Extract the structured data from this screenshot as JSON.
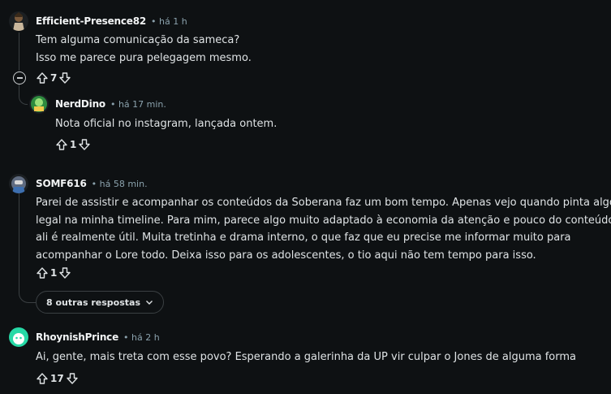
{
  "comments": [
    {
      "author": "Efficient-Presence82",
      "time": "há 1 h",
      "lines": [
        "Tem alguma comunicação da sameca?",
        "Isso me parece pura pelegagem mesmo."
      ],
      "votes": "7",
      "avatar_icon": "snoo-avatar-icon"
    },
    {
      "author": "NerdDino",
      "time": "há 17 min.",
      "lines": [
        "Nota oficial no instagram, lançada ontem."
      ],
      "votes": "1",
      "avatar_icon": "snoo-avatar-icon"
    },
    {
      "author": "SOMF616",
      "time": "há 58 min.",
      "lines": [
        "Parei de assistir e acompanhar os conteúdos da Soberana faz um bom tempo. Apenas vejo quando pinta algo",
        "legal na minha timeline. Para mim, parece algo muito adaptado à economia da atenção e pouco do conteúdo",
        "ali é realmente útil. Muita tretinha e drama interno, o que faz que eu precise me informar muito para",
        "acompanhar o Lore todo. Deixa isso para os adolescentes, o tio aqui não tem tempo para isso."
      ],
      "votes": "1",
      "more_replies": "8 outras respostas",
      "avatar_icon": "snoo-avatar-icon"
    },
    {
      "author": "RhoynishPrince",
      "time": "há 2 h",
      "lines": [
        "Ai, gente, mais treta com esse povo? Esperando a galerinha da UP vir culpar o Jones de alguma forma"
      ],
      "votes": "17",
      "avatar_icon": "snoo-avatar-icon"
    }
  ],
  "separator": "•",
  "colors": {
    "background": "#0e1113",
    "text": "#dfe3e5",
    "meta": "#8ba2ad",
    "thread_line": "#3b4043"
  }
}
